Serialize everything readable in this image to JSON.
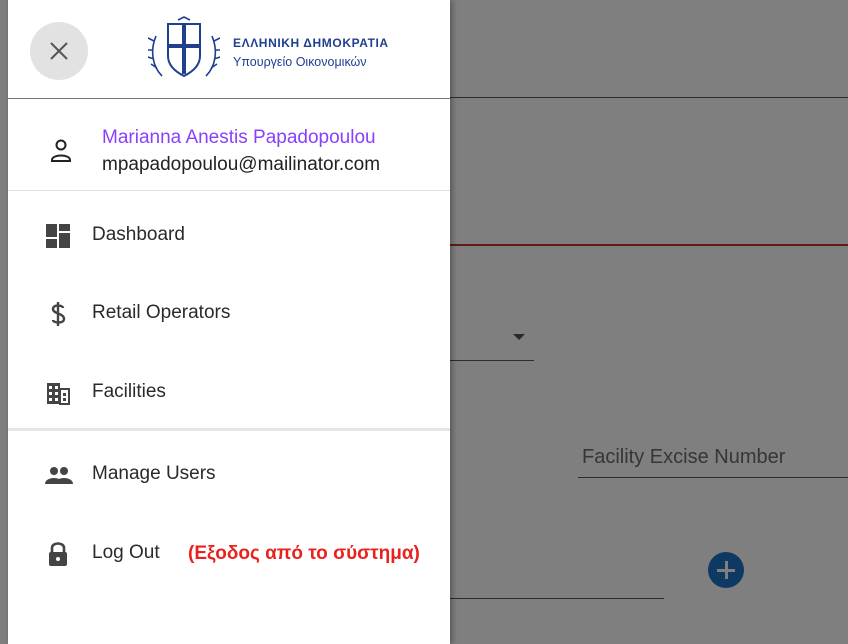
{
  "header": {
    "close_icon": "close-icon",
    "brand_title": "ΕΛΛΗΝΙΚΗ ΔΗΜΟΚΡΑΤΙΑ",
    "brand_subtitle": "Υπουργείο Οικονομικών",
    "brand_color": "#1f3f8f"
  },
  "user": {
    "icon": "person-icon",
    "name": "Marianna Anestis Papadopoulou",
    "email": "mpapadopoulou@mailinator.com",
    "name_color": "#8a3ffc"
  },
  "nav": {
    "items": [
      {
        "label": "Dashboard",
        "icon": "dashboard-icon"
      },
      {
        "label": "Retail Operators",
        "icon": "dollar-icon"
      },
      {
        "label": "Facilities",
        "icon": "building-icon"
      },
      {
        "label": "Manage Users",
        "icon": "group-icon"
      },
      {
        "label": "Log Out",
        "icon": "lock-icon"
      }
    ],
    "logout_hint": "(Εξοδος από το σύστημα)",
    "logout_hint_color": "#e8231e"
  },
  "background": {
    "field_label": "Facility Excise Number",
    "add_icon": "add-circle-icon",
    "accent_color": "#1b73c7"
  }
}
